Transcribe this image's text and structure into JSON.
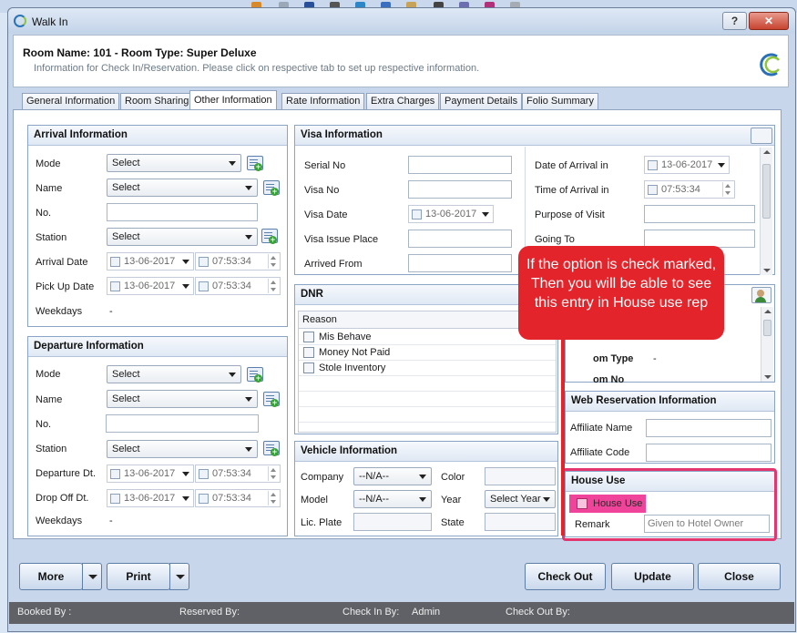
{
  "window": {
    "title": "Walk In",
    "help_label": "?",
    "close_label": "✕"
  },
  "header": {
    "room_name": "Room Name: 101 - Room Type: Super Deluxe",
    "info": "Information for Check In/Reservation. Please click on respective tab to set up respective information."
  },
  "tabs": [
    "General Information",
    "Room Sharing",
    "Other Information",
    "Rate Information",
    "Extra Charges",
    "Payment Details",
    "Folio Summary"
  ],
  "arrival": {
    "title": "Arrival Information",
    "mode_label": "Mode",
    "mode_value": "Select",
    "name_label": "Name",
    "name_value": "Select",
    "no_label": "No.",
    "station_label": "Station",
    "station_value": "Select",
    "arrival_date_label": "Arrival Date",
    "arrival_date": "13-06-2017",
    "arrival_time": "07:53:34",
    "pickup_label": "Pick Up Date",
    "pickup_date": "13-06-2017",
    "pickup_time": "07:53:34",
    "weekdays_label": "Weekdays",
    "weekdays_value": "-"
  },
  "departure": {
    "title": "Departure Information",
    "mode_label": "Mode",
    "mode_value": "Select",
    "name_label": "Name",
    "name_value": "Select",
    "no_label": "No.",
    "station_label": "Station",
    "station_value": "Select",
    "departure_label": "Departure Dt.",
    "departure_date": "13-06-2017",
    "departure_time": "07:53:34",
    "dropoff_label": "Drop Off Dt.",
    "dropoff_date": "13-06-2017",
    "dropoff_time": "07:53:34",
    "weekdays_label": "Weekdays",
    "weekdays_value": "-"
  },
  "visa": {
    "title": "Visa Information",
    "serial_label": "Serial No",
    "visa_no_label": "Visa No",
    "visa_date_label": "Visa Date",
    "visa_date": "13-06-2017",
    "issue_place_label": "Visa Issue Place",
    "arrived_from_label": "Arrived From",
    "arrival_date_label": "Date of Arrival in",
    "arrival_date": "13-06-2017",
    "arrival_time_label": "Time of Arrival in",
    "arrival_time": "07:53:34",
    "purpose_label": "Purpose of Visit",
    "going_to_label": "Going To"
  },
  "dnr": {
    "title": "DNR",
    "column": "Reason",
    "items": [
      "Mis Behave",
      "Money Not Paid",
      "Stole Inventory"
    ]
  },
  "vehicle": {
    "title": "Vehicle Information",
    "company_label": "Company",
    "company_value": "--N/A--",
    "model_label": "Model",
    "model_value": "--N/A--",
    "plate_label": "Lic. Plate",
    "color_label": "Color",
    "year_label": "Year",
    "year_value": "Select Year",
    "state_label": "State"
  },
  "room_panel": {
    "room_type_label": "om Type",
    "room_type_value": "-",
    "room_no_label": "om No"
  },
  "web_reservation": {
    "title": "Web Reservation Information",
    "affiliate_name_label": "Affiliate Name",
    "affiliate_code_label": "Affiliate Code"
  },
  "house_use": {
    "title": "House Use",
    "checkbox_label": "House Use",
    "remark_label": "Remark",
    "remark_value": "Given to Hotel Owner"
  },
  "callout": {
    "text": "If the option is check marked, Then you will be able to see this entry in House use rep"
  },
  "buttons": {
    "more": "More",
    "print": "Print",
    "check_out": "Check Out",
    "update": "Update",
    "close": "Close"
  },
  "status": {
    "booked_by": "Booked By :",
    "reserved_by": "Reserved By:",
    "check_in_by": "Check In By:",
    "check_in_by_value": "Admin",
    "check_out_by": "Check Out By:"
  },
  "colors": {
    "callout": "#e3242b",
    "highlight": "#e4366e",
    "house_use_bg": "#f0449b"
  }
}
